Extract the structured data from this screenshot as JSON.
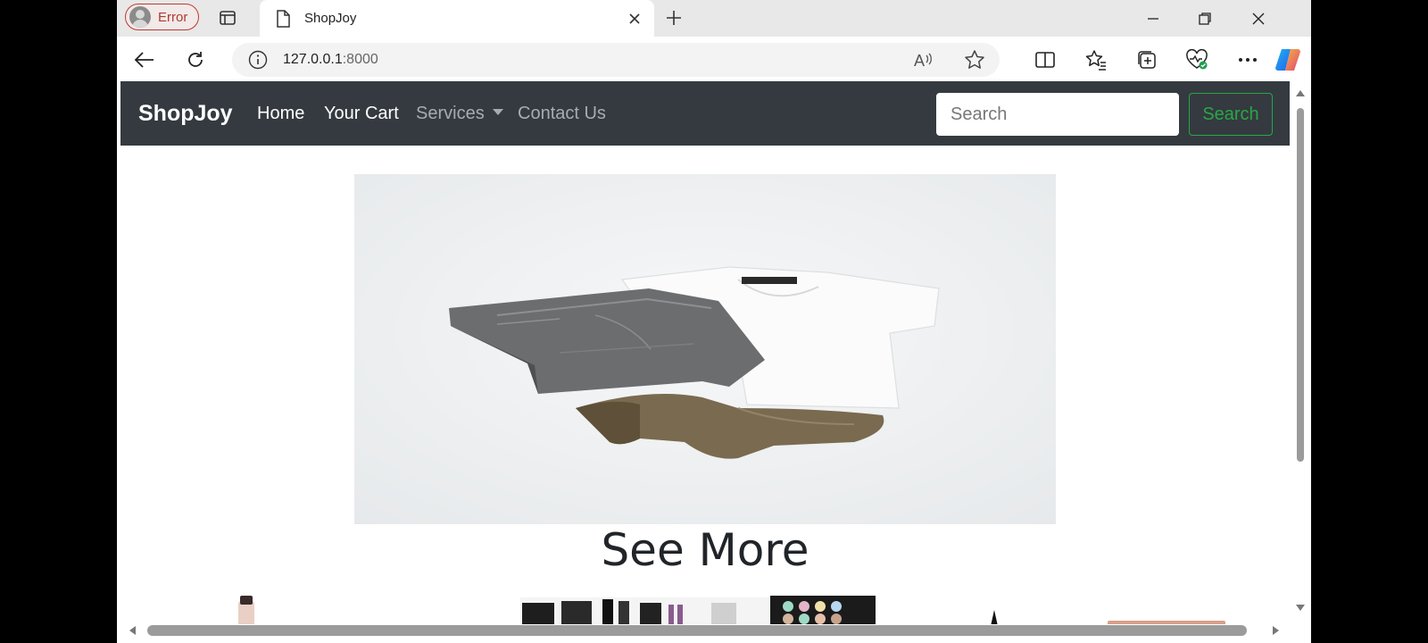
{
  "browser": {
    "profile_label": "Error",
    "tab_title": "ShopJoy",
    "url_host": "127.0.0.1",
    "url_port": ":8000",
    "icons": {
      "profile": "person-avatar-icon",
      "workspaces": "tab-actions-icon",
      "page": "page-icon",
      "close": "close-icon",
      "new_tab": "plus-icon",
      "minimize": "minimize-icon",
      "restore": "restore-icon",
      "close_window": "close-window-icon",
      "back": "back-arrow-icon",
      "refresh": "refresh-icon",
      "info": "info-icon",
      "read_aloud": "read-aloud-icon",
      "favorite": "star-icon",
      "split": "split-screen-icon",
      "favorites": "favorites-icon",
      "collections": "collections-icon",
      "performance": "browser-essentials-icon",
      "more": "more-icon",
      "copilot": "copilot-icon"
    }
  },
  "navbar": {
    "brand": "ShopJoy",
    "links": [
      {
        "label": "Home",
        "active": true
      },
      {
        "label": "Your Cart",
        "active": true
      },
      {
        "label": "Services",
        "dropdown": true
      },
      {
        "label": "Contact Us"
      }
    ],
    "search_placeholder": "Search",
    "search_button": "Search",
    "colors": {
      "background": "#343a40",
      "success": "#28a745"
    }
  },
  "main": {
    "heading": "See More"
  }
}
